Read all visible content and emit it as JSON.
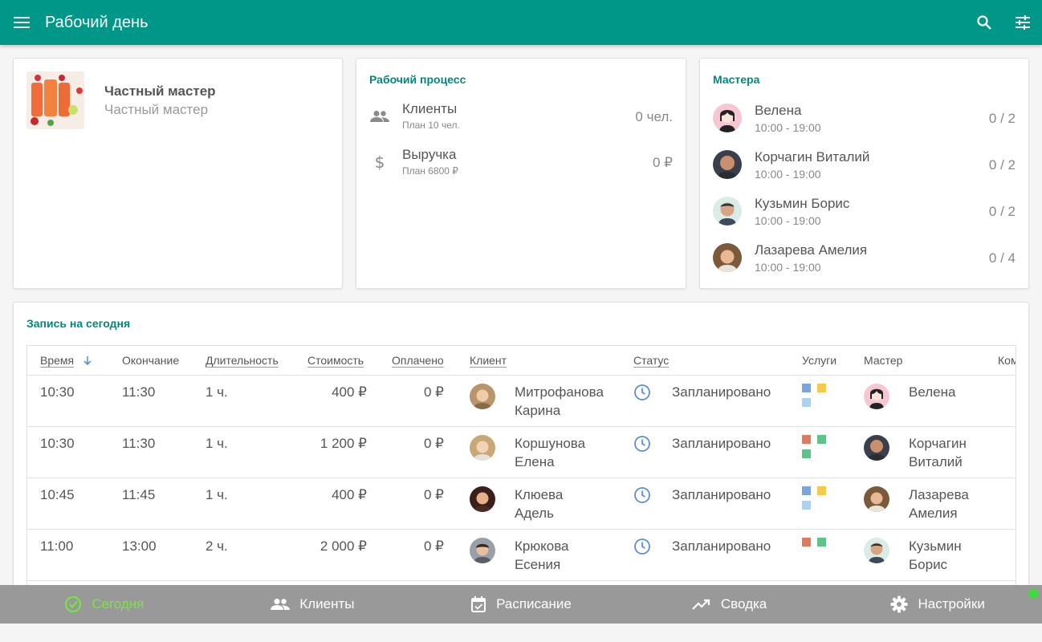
{
  "appbar": {
    "title": "Рабочий день",
    "icons": [
      "menu-icon",
      "search-icon",
      "tune-icon"
    ],
    "color": "#009688"
  },
  "profile": {
    "name": "Частный мастер",
    "subtitle": "Частный мастер"
  },
  "process": {
    "title": "Рабочий процесс",
    "rows": [
      {
        "label": "Клиенты",
        "plan": "План 10 чел.",
        "value": "0 чел.",
        "icon": "people-icon"
      },
      {
        "label": "Выручка",
        "plan": "План 6800 ₽",
        "value": "0 ₽",
        "icon": "dollar-icon"
      }
    ]
  },
  "masters": {
    "title": "Мастера",
    "items": [
      {
        "name": "Велена",
        "hours": "10:00 - 19:00",
        "count": "0 / 2"
      },
      {
        "name": "Корчагин Виталий",
        "hours": "10:00 - 19:00",
        "count": "0 / 2"
      },
      {
        "name": "Кузьмин Борис",
        "hours": "10:00 - 19:00",
        "count": "0 / 2"
      },
      {
        "name": "Лазарева Амелия",
        "hours": "10:00 - 19:00",
        "count": "0 / 4"
      }
    ]
  },
  "appointments": {
    "title": "Запись на сегодня",
    "columns": {
      "time": "Время",
      "end": "Окончание",
      "duration": "Длительность",
      "cost": "Стоимость",
      "paid": "Оплачено",
      "client": "Клиент",
      "status": "Статус",
      "services": "Услуги",
      "master": "Мастер",
      "comment": "Ком"
    },
    "rows": [
      {
        "time": "10:30",
        "end": "11:30",
        "duration": "1 ч.",
        "cost": "400 ₽",
        "paid": "0 ₽",
        "client_first": "Митрофанова",
        "client_last": "Карина",
        "status": "Запланировано",
        "services": [
          "#7aa6e0",
          "#f4c94e",
          "#a9d3f0"
        ],
        "master_first": "Велена",
        "master_last": ""
      },
      {
        "time": "10:30",
        "end": "11:30",
        "duration": "1 ч.",
        "cost": "1 200 ₽",
        "paid": "0 ₽",
        "client_first": "Коршунова",
        "client_last": "Елена",
        "status": "Запланировано",
        "services": [
          "#e07a5f",
          "#5fc28a",
          "#5fc28a"
        ],
        "master_first": "Корчагин",
        "master_last": "Виталий"
      },
      {
        "time": "10:45",
        "end": "11:45",
        "duration": "1 ч.",
        "cost": "400 ₽",
        "paid": "0 ₽",
        "client_first": "Клюева",
        "client_last": "Адель",
        "status": "Запланировано",
        "services": [
          "#7aa6e0",
          "#f4c94e",
          "#a9d3f0"
        ],
        "master_first": "Лазарева",
        "master_last": "Амелия"
      },
      {
        "time": "11:00",
        "end": "13:00",
        "duration": "2 ч.",
        "cost": "2 000 ₽",
        "paid": "0 ₽",
        "client_first": "Крюкова",
        "client_last": "Есения",
        "status": "Запланировано",
        "services": [
          "#e07a5f",
          "#5fc28a"
        ],
        "master_first": "Кузьмин",
        "master_last": "Борис"
      }
    ]
  },
  "bottomnav": {
    "items": [
      {
        "label": "Сегодня",
        "icon": "check-circle-icon",
        "active": true
      },
      {
        "label": "Клиенты",
        "icon": "people-icon",
        "active": false
      },
      {
        "label": "Расписание",
        "icon": "calendar-icon",
        "active": false
      },
      {
        "label": "Сводка",
        "icon": "trending-up-icon",
        "active": false
      },
      {
        "label": "Настройки",
        "icon": "gear-icon",
        "active": false
      }
    ]
  }
}
